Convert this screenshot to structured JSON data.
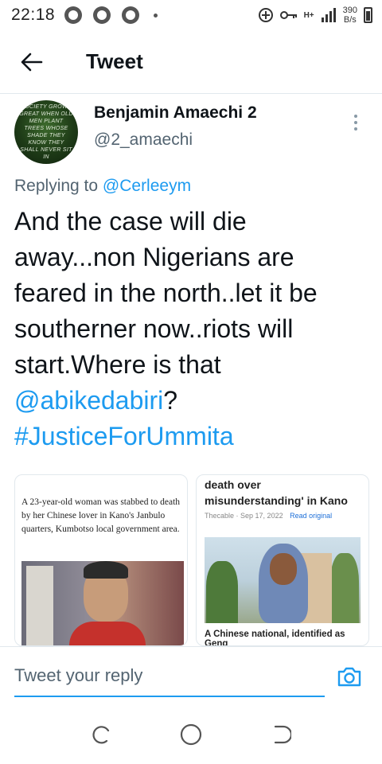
{
  "status_bar": {
    "time": "22:18",
    "network_type": "H+",
    "speed_value": "390",
    "speed_unit": "B/s"
  },
  "header": {
    "title": "Tweet"
  },
  "tweet": {
    "author_name": "Benjamin Amaechi 2",
    "author_handle": "@2_amaechi",
    "avatar_text": "Society grows great when old men plant trees whose shade they know they shall never sit in",
    "replying_prefix": "Replying to",
    "replying_to": "@Cerleeym",
    "text_main": "And the case will die away...non Nigerians are feared in the north..let it be southerner now..riots will start.Where is that ",
    "mention": "@abikedabiri",
    "question_mark": "?",
    "hashtag": "#JusticeForUmmita",
    "media": {
      "card1_text": "A 23-year-old woman was stabbed to death by her Chinese lover in Kano's Janbulo quarters, Kumbotso local government area.",
      "card2_headline": "death over misunderstanding' in Kano",
      "card2_source": "Thecable",
      "card2_date": "Sep 17, 2022",
      "card2_read": "Read original",
      "card2_bottom": "A Chinese national, identified as Geng"
    }
  },
  "reply_bar": {
    "placeholder": "Tweet your reply"
  },
  "colors": {
    "accent": "#1d9bf0",
    "text_primary": "#0f1419",
    "text_secondary": "#536471",
    "divider": "#e1e8ed"
  }
}
